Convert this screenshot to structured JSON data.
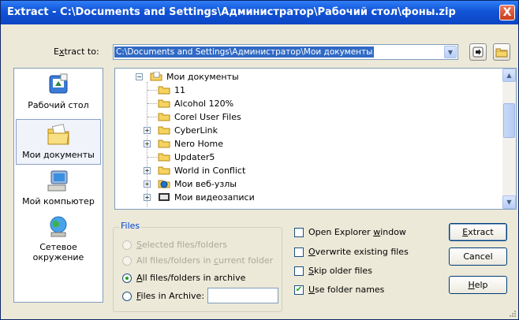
{
  "window": {
    "title": "Extract - C:\\Documents and Settings\\Администратор\\Рабочий стол\\фоны.zip",
    "close_glyph": "X"
  },
  "extract_to": {
    "label_pre": "E",
    "label_u": "x",
    "label_post": "tract to:",
    "value": "C:\\Documents and Settings\\Администратор\\Мои документы"
  },
  "places": [
    {
      "label": "Рабочий стол",
      "icon": "desktop-icon"
    },
    {
      "label": "Мои документы",
      "icon": "my-documents-icon",
      "selected": true
    },
    {
      "label": "Мой компьютер",
      "icon": "my-computer-icon"
    },
    {
      "label": "Сетевое окружение",
      "icon": "network-icon"
    }
  ],
  "tree": [
    {
      "label": "Мои документы",
      "expander": "−",
      "icon": "my-documents-folder-icon"
    },
    {
      "label": "11",
      "expander": "",
      "icon": "folder-icon"
    },
    {
      "label": "Alcohol 120%",
      "expander": "",
      "icon": "folder-icon"
    },
    {
      "label": "Corel User Files",
      "expander": "",
      "icon": "folder-icon"
    },
    {
      "label": "CyberLink",
      "expander": "+",
      "icon": "folder-icon"
    },
    {
      "label": "Nero Home",
      "expander": "+",
      "icon": "folder-icon"
    },
    {
      "label": "Updater5",
      "expander": "",
      "icon": "folder-icon"
    },
    {
      "label": "World in Conflict",
      "expander": "+",
      "icon": "folder-icon"
    },
    {
      "label": "Мои веб-узлы",
      "expander": "+",
      "icon": "web-folder-icon"
    },
    {
      "label": "Мои видеозаписи",
      "expander": "+",
      "icon": "video-folder-icon"
    }
  ],
  "files": {
    "legend": "Files",
    "options": [
      {
        "pre": "",
        "u": "S",
        "post": "elected files/folders",
        "enabled": false,
        "checked": false
      },
      {
        "pre": "All files/folders in ",
        "u": "c",
        "post": "urrent folder",
        "enabled": false,
        "checked": false
      },
      {
        "pre": "",
        "u": "A",
        "post": "ll files/folders in archive",
        "enabled": true,
        "checked": true
      },
      {
        "pre": "",
        "u": "F",
        "post": "iles in Archive:",
        "enabled": true,
        "checked": false
      }
    ],
    "files_in_archive_value": ""
  },
  "checkboxes": [
    {
      "pre": "Open Explorer ",
      "u": "w",
      "post": "indow",
      "checked": false
    },
    {
      "pre": "",
      "u": "O",
      "post": "verwrite existing files",
      "checked": false
    },
    {
      "pre": "",
      "u": "S",
      "post": "kip older files",
      "checked": false
    },
    {
      "pre": "",
      "u": "U",
      "post": "se folder names",
      "checked": true
    }
  ],
  "buttons": {
    "extract": {
      "pre": "",
      "u": "E",
      "post": "xtract"
    },
    "cancel": {
      "label": "Cancel"
    },
    "help": {
      "pre": "",
      "u": "H",
      "post": "elp"
    }
  },
  "colors": {
    "titlebar": "#0b46c4",
    "selection": "#316ac5",
    "face": "#ece9d8"
  }
}
